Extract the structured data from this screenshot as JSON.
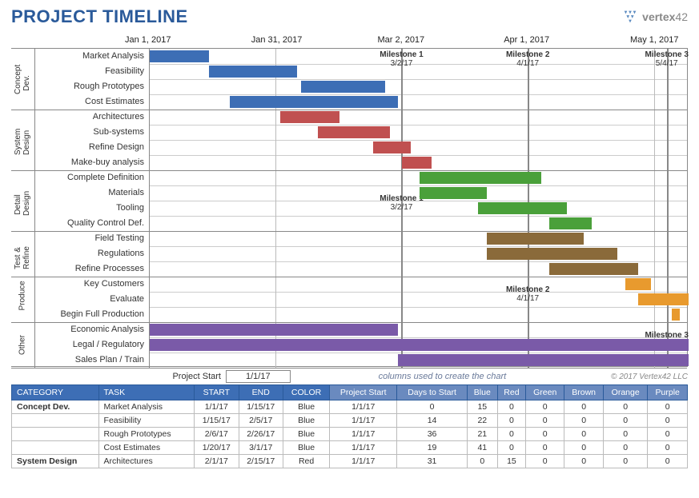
{
  "title": "PROJECT TIMELINE",
  "logo": {
    "name": "vertex42"
  },
  "project_start": {
    "label": "Project Start",
    "value": "1/1/17"
  },
  "cols_note": "columns used to create the chart",
  "copyright": "© 2017 Vertex42 LLC",
  "chart_data": {
    "type": "bar",
    "title": "PROJECT TIMELINE",
    "xlabel": "",
    "ylabel": "",
    "x_range": [
      "2017-01-01",
      "2017-05-09"
    ],
    "ticks": [
      {
        "label": "Jan 1, 2017",
        "date": "2017-01-01"
      },
      {
        "label": "Jan 31, 2017",
        "date": "2017-01-31"
      },
      {
        "label": "Mar 2, 2017",
        "date": "2017-03-02"
      },
      {
        "label": "Apr 1, 2017",
        "date": "2017-04-01"
      },
      {
        "label": "May 1, 2017",
        "date": "2017-05-01"
      }
    ],
    "milestones": [
      {
        "name": "Milestone 1",
        "date": "3/2/17",
        "iso": "2017-03-02"
      },
      {
        "name": "Milestone 2",
        "date": "4/1/17",
        "iso": "2017-04-01"
      },
      {
        "name": "Milestone 3",
        "date": "5/4/17",
        "iso": "2017-05-04"
      }
    ],
    "milestone_callouts": [
      {
        "name": "Milestone 1",
        "date": "3/2/17",
        "iso": "2017-03-02",
        "row": 10
      },
      {
        "name": "Milestone 2",
        "date": "4/1/17",
        "iso": "2017-04-01",
        "row": 16
      },
      {
        "name": "Milestone 3",
        "date": "5/4/17",
        "iso": "2017-05-04",
        "row": 19
      }
    ],
    "groups": [
      {
        "name": "Concept Dev.",
        "tasks": [
          {
            "name": "Market Analysis",
            "start": "2017-01-01",
            "end": "2017-01-15",
            "color": "blue"
          },
          {
            "name": "Feasibility",
            "start": "2017-01-15",
            "end": "2017-02-05",
            "color": "blue"
          },
          {
            "name": "Rough Prototypes",
            "start": "2017-02-06",
            "end": "2017-02-26",
            "color": "blue"
          },
          {
            "name": "Cost Estimates",
            "start": "2017-01-20",
            "end": "2017-03-01",
            "color": "blue"
          }
        ]
      },
      {
        "name": "System Design",
        "tasks": [
          {
            "name": "Architectures",
            "start": "2017-02-01",
            "end": "2017-02-15",
            "color": "red"
          },
          {
            "name": "Sub-systems",
            "start": "2017-02-10",
            "end": "2017-02-27",
            "color": "red"
          },
          {
            "name": "Refine Design",
            "start": "2017-02-23",
            "end": "2017-03-04",
            "color": "red"
          },
          {
            "name": "Make-buy analysis",
            "start": "2017-03-02",
            "end": "2017-03-09",
            "color": "red"
          }
        ]
      },
      {
        "name": "Detail Design",
        "tasks": [
          {
            "name": "Complete Definition",
            "start": "2017-03-06",
            "end": "2017-04-04",
            "color": "green"
          },
          {
            "name": "Materials",
            "start": "2017-03-06",
            "end": "2017-03-22",
            "color": "green"
          },
          {
            "name": "Tooling",
            "start": "2017-03-20",
            "end": "2017-04-10",
            "color": "green"
          },
          {
            "name": "Quality Control Def.",
            "start": "2017-04-06",
            "end": "2017-04-16",
            "color": "green"
          }
        ]
      },
      {
        "name": "Test & Refine",
        "tasks": [
          {
            "name": "Field Testing",
            "start": "2017-03-22",
            "end": "2017-04-14",
            "color": "brown"
          },
          {
            "name": "Regulations",
            "start": "2017-03-22",
            "end": "2017-04-22",
            "color": "brown"
          },
          {
            "name": "Refine Processes",
            "start": "2017-04-06",
            "end": "2017-04-27",
            "color": "brown"
          }
        ]
      },
      {
        "name": "Produce",
        "tasks": [
          {
            "name": "Key Customers",
            "start": "2017-04-24",
            "end": "2017-04-30",
            "color": "orange"
          },
          {
            "name": "Evaluate",
            "start": "2017-04-27",
            "end": "2017-05-09",
            "color": "orange"
          },
          {
            "name": "Begin Full Production",
            "start": "2017-05-05",
            "end": "2017-05-07",
            "color": "orange"
          }
        ]
      },
      {
        "name": "Other",
        "tasks": [
          {
            "name": "Economic Analysis",
            "start": "2017-01-01",
            "end": "2017-03-01",
            "color": "purple"
          },
          {
            "name": "Legal / Regulatory",
            "start": "2017-01-01",
            "end": "2017-05-09",
            "color": "purple"
          },
          {
            "name": "Sales Plan / Train",
            "start": "2017-03-01",
            "end": "2017-05-09",
            "color": "purple"
          }
        ]
      }
    ],
    "colors": {
      "blue": "#3d6eb5",
      "red": "#c05050",
      "green": "#4aa03a",
      "brown": "#8a6a3a",
      "orange": "#e89a2e",
      "purple": "#7a5aa8"
    }
  },
  "table": {
    "headers_main": [
      "CATEGORY",
      "TASK",
      "START",
      "END",
      "COLOR"
    ],
    "headers_sub": [
      "Project Start",
      "Days to Start",
      "Blue",
      "Red",
      "Green",
      "Brown",
      "Orange",
      "Purple"
    ],
    "rows": [
      {
        "category": "Concept Dev.",
        "task": "Market Analysis",
        "start": "1/1/17",
        "end": "1/15/17",
        "color": "Blue",
        "ps": "1/1/17",
        "dts": 0,
        "blue": 15,
        "red": 0,
        "green": 0,
        "brown": 0,
        "orange": 0,
        "purple": 0
      },
      {
        "category": "",
        "task": "Feasibility",
        "start": "1/15/17",
        "end": "2/5/17",
        "color": "Blue",
        "ps": "1/1/17",
        "dts": 14,
        "blue": 22,
        "red": 0,
        "green": 0,
        "brown": 0,
        "orange": 0,
        "purple": 0
      },
      {
        "category": "",
        "task": "Rough Prototypes",
        "start": "2/6/17",
        "end": "2/26/17",
        "color": "Blue",
        "ps": "1/1/17",
        "dts": 36,
        "blue": 21,
        "red": 0,
        "green": 0,
        "brown": 0,
        "orange": 0,
        "purple": 0
      },
      {
        "category": "",
        "task": "Cost Estimates",
        "start": "1/20/17",
        "end": "3/1/17",
        "color": "Blue",
        "ps": "1/1/17",
        "dts": 19,
        "blue": 41,
        "red": 0,
        "green": 0,
        "brown": 0,
        "orange": 0,
        "purple": 0
      },
      {
        "category": "System Design",
        "task": "Architectures",
        "start": "2/1/17",
        "end": "2/15/17",
        "color": "Red",
        "ps": "1/1/17",
        "dts": 31,
        "blue": 0,
        "red": 15,
        "green": 0,
        "brown": 0,
        "orange": 0,
        "purple": 0
      }
    ]
  }
}
